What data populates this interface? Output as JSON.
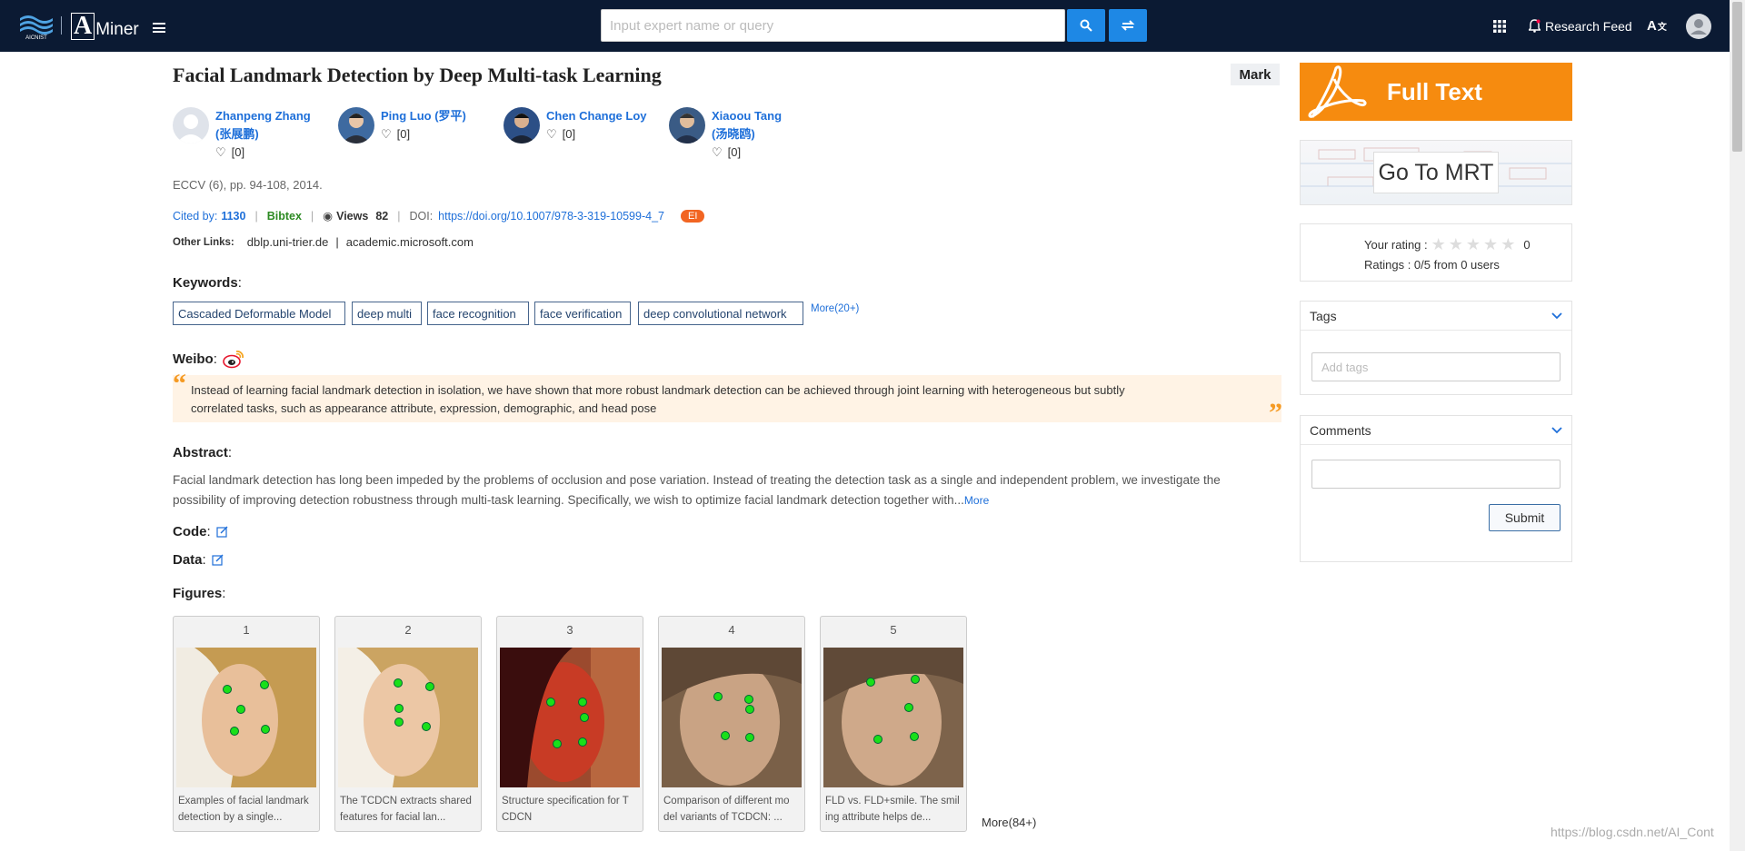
{
  "header": {
    "logo_aminer_text": "Miner",
    "logo_aminer_letter": "A",
    "search_placeholder": "Input expert name or query",
    "research_feed": "Research Feed"
  },
  "paper": {
    "title": "Facial Landmark Detection by Deep Multi-task Learning",
    "mark_label": "Mark",
    "authors": [
      {
        "name_line1": "Zhanpeng Zhang",
        "name_line2": "(张展鹏)",
        "likes": "[0]"
      },
      {
        "name_line1": "Ping Luo (罗平)",
        "name_line2": "",
        "likes": "[0]"
      },
      {
        "name_line1": "Chen Change Loy",
        "name_line2": "",
        "likes": "[0]"
      },
      {
        "name_line1": "Xiaoou Tang",
        "name_line2": "(汤晓鸥)",
        "likes": "[0]"
      }
    ],
    "venue": "ECCV (6), pp. 94-108, 2014.",
    "cited_by_label": "Cited by:",
    "cited_by": "1130",
    "bibtex": "Bibtex",
    "views_label": "Views",
    "views": "82",
    "doi_label": "DOI:",
    "doi": "https://doi.org/10.1007/978-3-319-10599-4_7",
    "ei_badge": "EI",
    "other_links_label": "Other Links:",
    "other_links": [
      "dblp.uni-trier.de",
      "academic.microsoft.com"
    ]
  },
  "keywords": {
    "heading": "Keywords",
    "items": [
      "Cascaded Deformable Model",
      "deep multi",
      "face recognition",
      "face verification",
      "deep convolutional network"
    ],
    "more": "More(20+)"
  },
  "weibo": {
    "heading": "Weibo",
    "text_line1": "Instead of learning facial landmark detection in isolation, we have shown that more robust landmark detection can be achieved through joint learning with heterogeneous but subtly",
    "text_line2": "correlated tasks, such as appearance attribute, expression, demographic, and head pose"
  },
  "abstract": {
    "heading": "Abstract",
    "text_line1": "Facial landmark detection has long been impeded by the problems of occlusion and pose variation. Instead of treating the detection task as a single and independent problem, we investigate the",
    "text_line2": "possibility of improving detection robustness through multi-task learning. Specifically, we wish to optimize facial landmark detection together with...",
    "more": "More"
  },
  "code_heading": "Code",
  "data_heading": "Data",
  "figures": {
    "heading": "Figures",
    "items": [
      {
        "num": "1",
        "cap1": "Examples of facial landmark",
        "cap2": "detection by a single..."
      },
      {
        "num": "2",
        "cap1": "The TCDCN extracts shared",
        "cap2": "features for facial lan..."
      },
      {
        "num": "3",
        "cap1": "Structure specification for T",
        "cap2": "CDCN"
      },
      {
        "num": "4",
        "cap1": "Comparison of different mo",
        "cap2": "del variants of TCDCN: ..."
      },
      {
        "num": "5",
        "cap1": "FLD vs. FLD+smile. The smil",
        "cap2": "ing attribute helps de..."
      }
    ],
    "more": "More(84+)"
  },
  "sidebar": {
    "full_text": "Full Text",
    "go_to_mrt": "Go To MRT",
    "your_rating_label": "Your rating :",
    "your_rating_value": "0",
    "ratings_summary": "Ratings : 0/5 from 0 users",
    "tags_heading": "Tags",
    "tags_placeholder": "Add tags",
    "comments_heading": "Comments",
    "submit": "Submit"
  },
  "watermark": "https://blog.csdn.net/AI_Cont"
}
